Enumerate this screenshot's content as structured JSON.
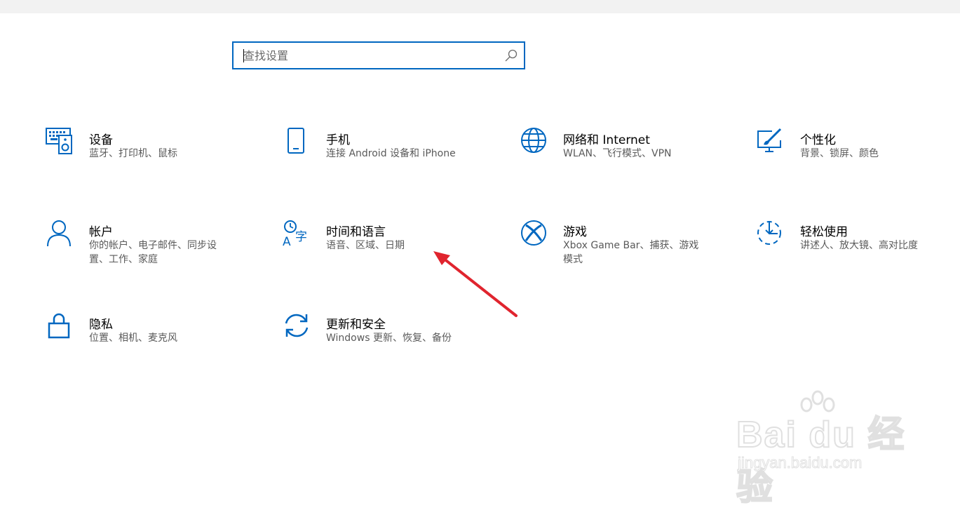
{
  "search": {
    "placeholder": "查找设置"
  },
  "tiles": [
    {
      "title": "设备",
      "desc": "蓝牙、打印机、鼠标",
      "icon": "keyboard-speaker-icon"
    },
    {
      "title": "手机",
      "desc": "连接 Android 设备和 iPhone",
      "icon": "phone-icon"
    },
    {
      "title": "网络和 Internet",
      "desc": "WLAN、飞行模式、VPN",
      "icon": "globe-icon"
    },
    {
      "title": "个性化",
      "desc": "背景、锁屏、颜色",
      "icon": "paint-brush-icon"
    },
    {
      "title": "帐户",
      "desc": "你的帐户、电子邮件、同步设置、工作、家庭",
      "icon": "person-icon"
    },
    {
      "title": "时间和语言",
      "desc": "语音、区域、日期",
      "icon": "time-language-icon"
    },
    {
      "title": "游戏",
      "desc": "Xbox Game Bar、捕获、游戏模式",
      "icon": "xbox-icon"
    },
    {
      "title": "轻松使用",
      "desc": "讲述人、放大镜、高对比度",
      "icon": "ease-of-access-icon"
    },
    {
      "title": "隐私",
      "desc": "位置、相机、麦克风",
      "icon": "lock-icon"
    },
    {
      "title": "更新和安全",
      "desc": "Windows 更新、恢复、备份",
      "icon": "sync-icon"
    }
  ],
  "colors": {
    "accent": "#0067c0",
    "annotation_arrow": "#e0242e"
  },
  "watermark": {
    "brand": "Bai du 经验",
    "url": "jingyan.baidu.com"
  }
}
